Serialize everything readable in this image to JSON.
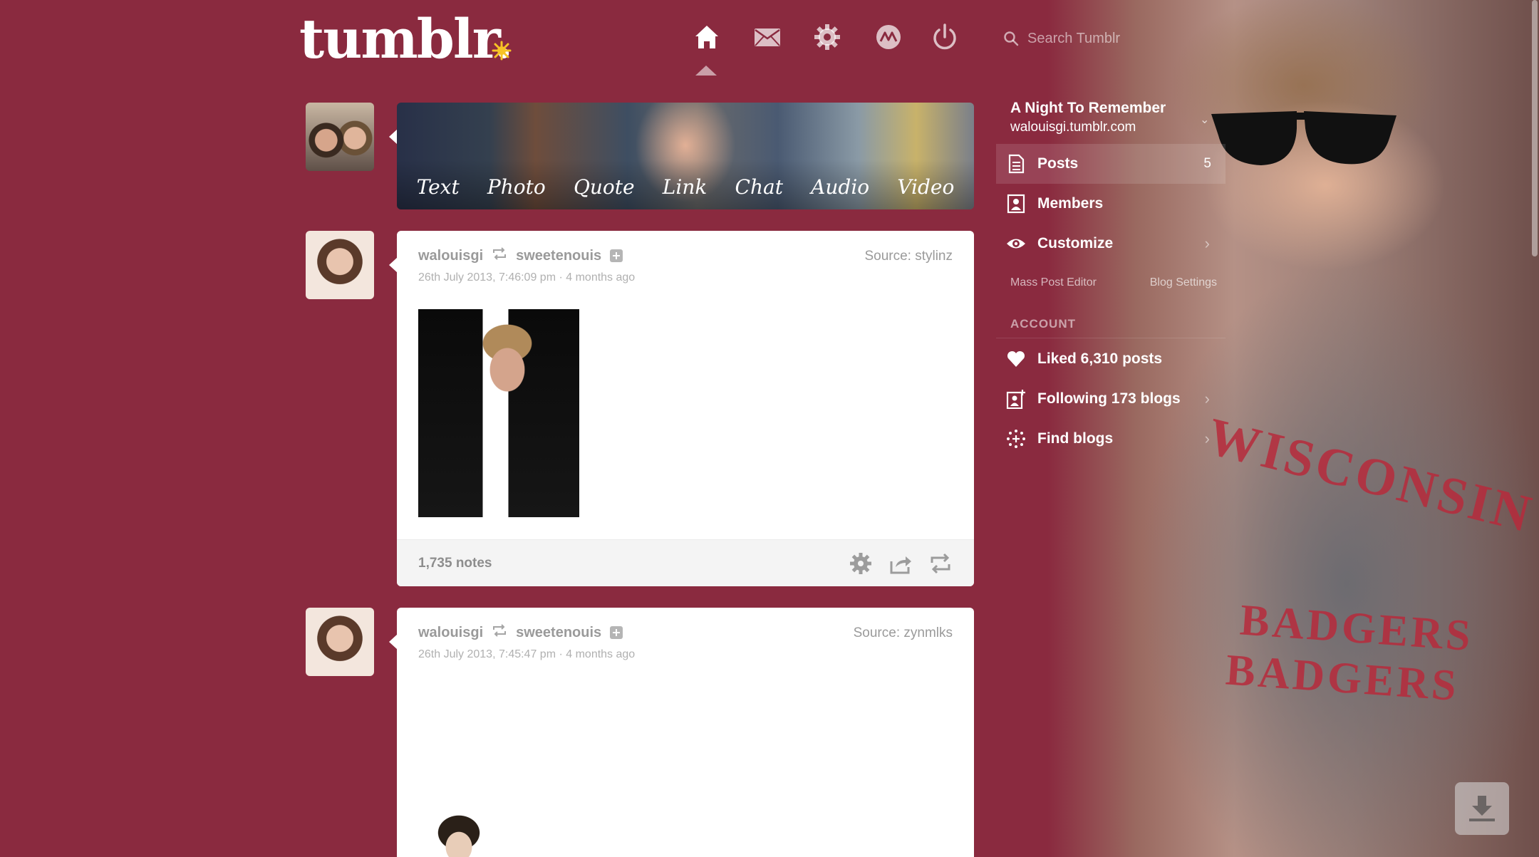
{
  "header": {
    "logo": "tumblr.",
    "nav": [
      {
        "name": "home-icon"
      },
      {
        "name": "mail-icon"
      },
      {
        "name": "gear-icon"
      },
      {
        "name": "activity-icon"
      },
      {
        "name": "power-icon"
      }
    ],
    "search_placeholder": "Search Tumblr"
  },
  "composer": {
    "types": [
      "Text",
      "Photo",
      "Quote",
      "Link",
      "Chat",
      "Audio",
      "Video"
    ]
  },
  "posts": [
    {
      "user": "walouisgi",
      "reblogged_from": "sweetenouis",
      "date": "26th July 2013, 7:46:09 pm · 4 months ago",
      "source": "Source: stylinz",
      "notes": "1,735 notes"
    },
    {
      "user": "walouisgi",
      "reblogged_from": "sweetenouis",
      "date": "26th July 2013, 7:45:47 pm · 4 months ago",
      "source": "Source: zynmlks"
    }
  ],
  "sidebar": {
    "blog_title": "A Night To Remember",
    "blog_url": "walouisgi.tumblr.com",
    "blog_toggle": "⌄",
    "items": [
      {
        "label": "Posts",
        "count": "5"
      },
      {
        "label": "Members"
      },
      {
        "label": "Customize"
      }
    ],
    "links": [
      "Mass Post Editor",
      "Blog Settings"
    ],
    "account_heading": "ACCOUNT",
    "account_items": [
      {
        "label": "Liked 6,310 posts"
      },
      {
        "label": "Following 173 blogs"
      },
      {
        "label": "Find blogs"
      }
    ]
  },
  "background_photo": {
    "shirt_lines": [
      "WISCONSIN",
      "BADGERS",
      "BADGERS"
    ]
  },
  "colors": {
    "background": "#8a2a3f",
    "accent_star": "#f7c325",
    "post_bg": "#ffffff",
    "muted_text": "#9a9a9a"
  }
}
